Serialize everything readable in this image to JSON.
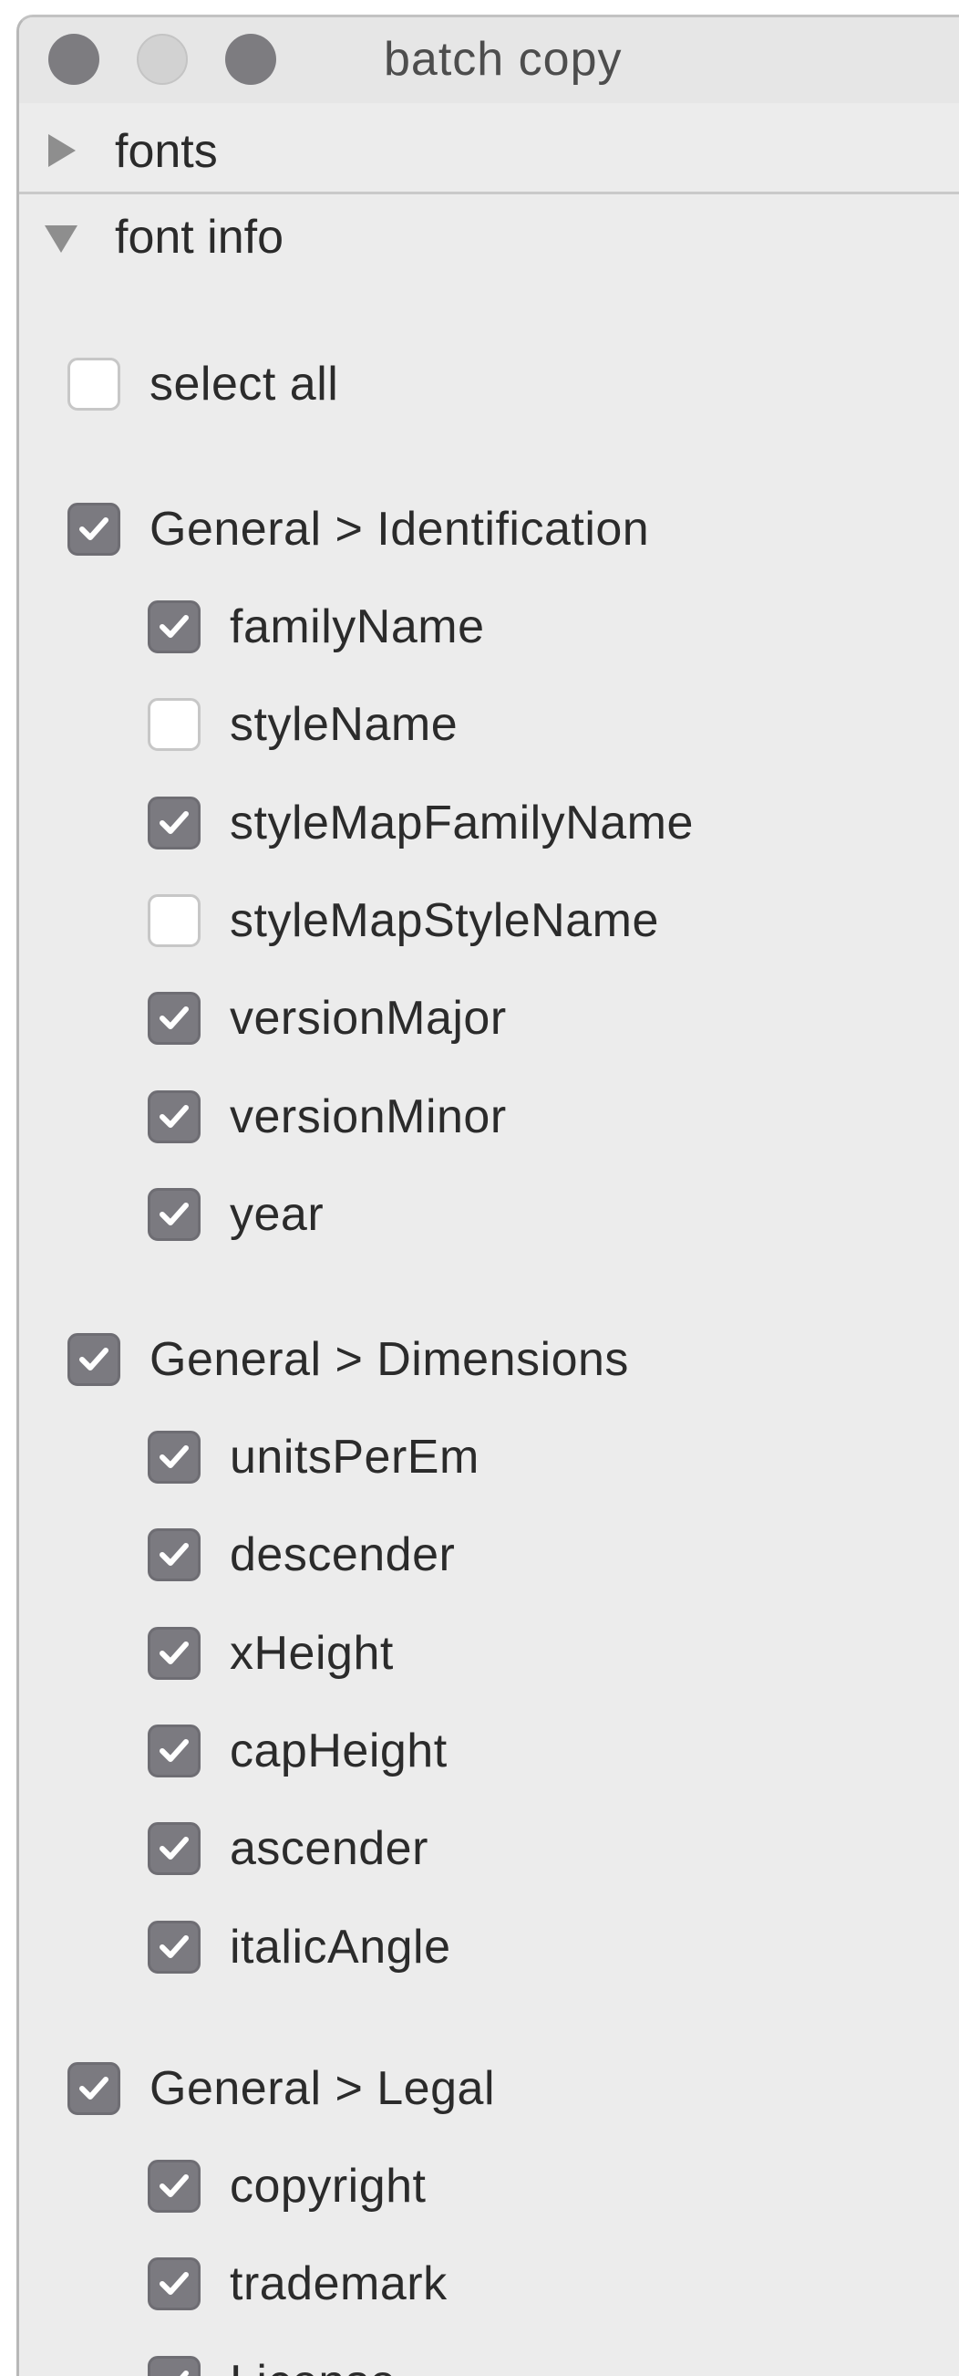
{
  "window": {
    "title": "batch copy"
  },
  "sections": {
    "fonts_label": "fonts",
    "font_info_label": "font info"
  },
  "select_all": {
    "label": "select all",
    "checked": false
  },
  "groups": [
    {
      "label": "General > Identification",
      "checked": true,
      "items": [
        {
          "label": "familyName",
          "checked": true
        },
        {
          "label": "styleName",
          "checked": false
        },
        {
          "label": "styleMapFamilyName",
          "checked": true
        },
        {
          "label": "styleMapStyleName",
          "checked": false
        },
        {
          "label": "versionMajor",
          "checked": true
        },
        {
          "label": "versionMinor",
          "checked": true
        },
        {
          "label": "year",
          "checked": true
        }
      ]
    },
    {
      "label": "General > Dimensions",
      "checked": true,
      "items": [
        {
          "label": "unitsPerEm",
          "checked": true
        },
        {
          "label": "descender",
          "checked": true
        },
        {
          "label": "xHeight",
          "checked": true
        },
        {
          "label": "capHeight",
          "checked": true
        },
        {
          "label": "ascender",
          "checked": true
        },
        {
          "label": "italicAngle",
          "checked": true
        }
      ]
    },
    {
      "label": "General > Legal",
      "checked": true,
      "items": [
        {
          "label": "copyright",
          "checked": true
        },
        {
          "label": "trademark",
          "checked": true
        },
        {
          "label": "License",
          "checked": true
        }
      ]
    }
  ],
  "icons": {
    "disclosure_collapsed": "triangle-right-icon",
    "disclosure_expanded": "triangle-down-icon",
    "check": "checkmark-icon"
  },
  "colors": {
    "checkbox_on": "#7b7a80",
    "window_bg": "#ececec"
  }
}
